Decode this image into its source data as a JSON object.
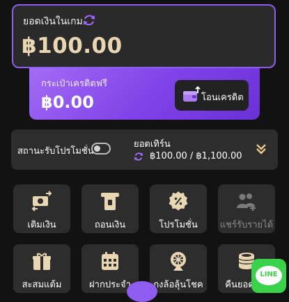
{
  "balance": {
    "label": "ยอดเงินในเกม",
    "amount": "฿100.00"
  },
  "wallet": {
    "label": "กระเป๋าเครดิตฟรี",
    "amount": "฿0.00",
    "transfer_label": "โอนเครดิต"
  },
  "promo": {
    "status_label": "สถานะรับโปรโมชั่น",
    "toggle_on": false,
    "turnover_label": "ยอดเทิร์น",
    "turnover_value": "฿100.00 / ฿1,100.00"
  },
  "menu": [
    {
      "label": "เติมเงิน",
      "icon": "deposit-cash-icon",
      "enabled": true
    },
    {
      "label": "ถอนเงิน",
      "icon": "withdraw-atm-icon",
      "enabled": true
    },
    {
      "label": "โปรโมชั่น",
      "icon": "promotion-badge-icon",
      "enabled": true
    },
    {
      "label": "แชร์รับรายได้",
      "icon": "share-users-icon",
      "enabled": false
    },
    {
      "label": "สะสมแต้ม",
      "icon": "gift-box-icon",
      "enabled": true
    },
    {
      "label": "ฝากประจำ",
      "icon": "calendar-icon",
      "enabled": true
    },
    {
      "label": "กงล้อลุ้นโชค",
      "icon": "fortune-wheel-icon",
      "enabled": true
    },
    {
      "label": "คืนยอดเสีย",
      "icon": "coin-stack-icon",
      "enabled": true
    }
  ],
  "line": {
    "label": "LINE"
  },
  "colors": {
    "accent": "#8f5cf0",
    "gold": "#e8d7b2",
    "line_green": "#3ad14b"
  }
}
